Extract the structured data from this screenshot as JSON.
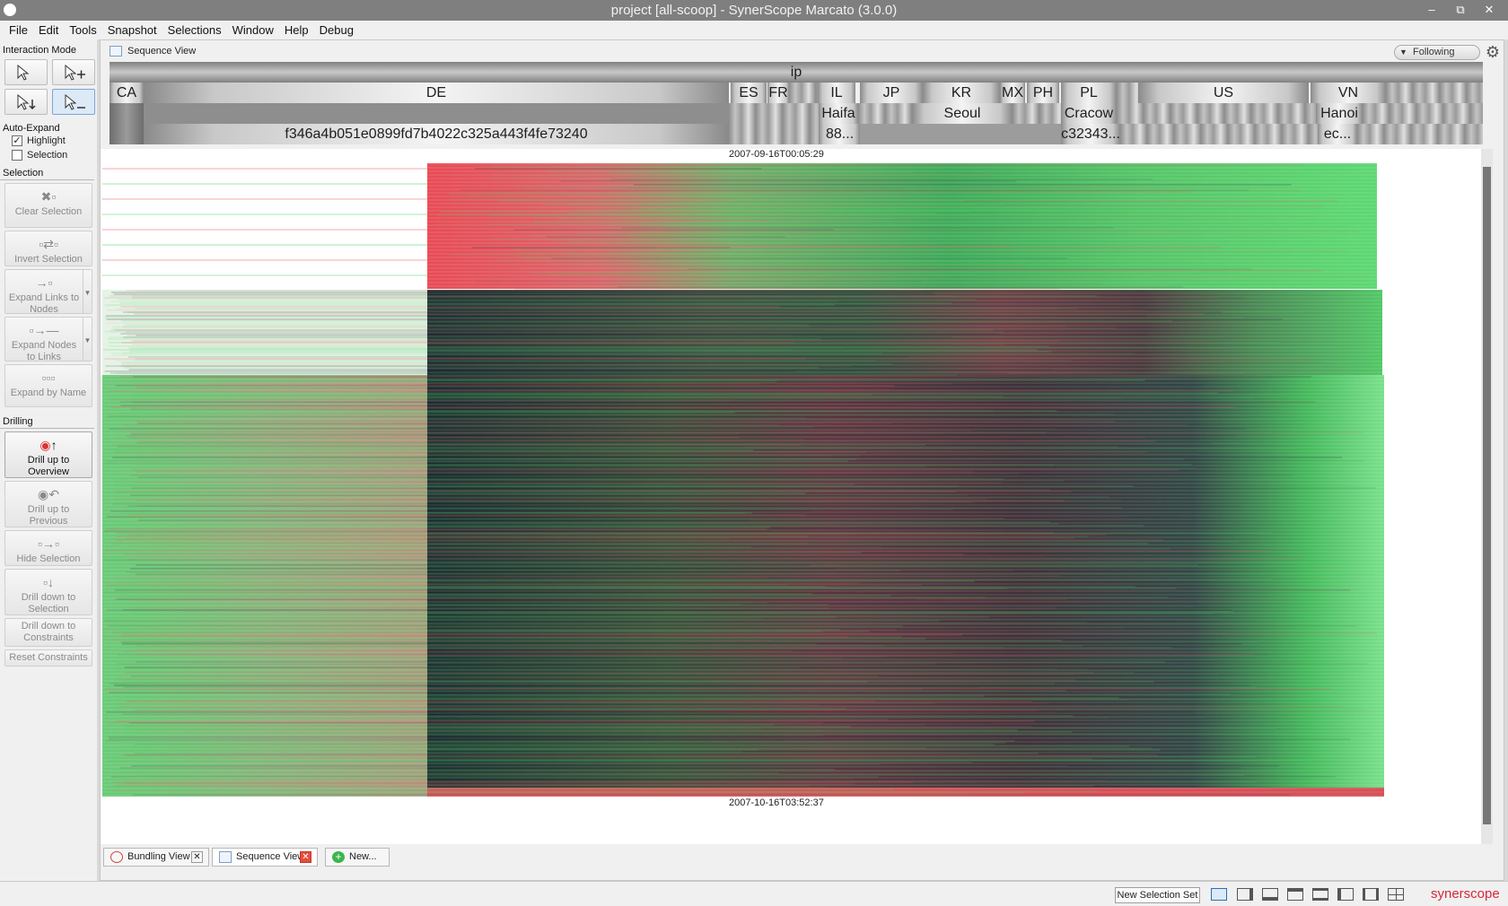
{
  "window": {
    "title": "project [all-scoop] - SynerScope Marcato (3.0.0)"
  },
  "menu": [
    "File",
    "Edit",
    "Tools",
    "Snapshot",
    "Selections",
    "Window",
    "Help",
    "Debug"
  ],
  "left_panel": {
    "interaction_mode_title": "Interaction Mode",
    "auto_expand_title": "Auto-Expand",
    "highlight_label": "Highlight",
    "highlight_checked": true,
    "selection_label": "Selection",
    "selection_checked": false,
    "selection_title": "Selection",
    "clear_selection": "Clear Selection",
    "invert_selection": "Invert Selection",
    "expand_links": "Expand Links to Nodes",
    "expand_nodes": "Expand Nodes to Links",
    "expand_by_name": "Expand by Name",
    "drilling_title": "Drilling",
    "drill_up_overview": "Drill up to Overview",
    "drill_up_previous": "Drill up to Previous",
    "hide_selection": "Hide Selection",
    "drill_down_selection": "Drill down to Selection",
    "drill_down_constraints": "Drill down to Constraints",
    "reset_constraints": "Reset Constraints"
  },
  "view": {
    "title": "Sequence View",
    "following_label": "Following",
    "hierarchy": {
      "root": "ip",
      "countries": [
        "CA",
        "DE",
        "ES",
        "FR",
        "IL",
        "JP",
        "KR",
        "MX",
        "PH",
        "PL",
        "US",
        "VN"
      ],
      "cities": [
        "Haifa",
        "Seoul",
        "Cracow",
        "Hanoi"
      ],
      "hosts": [
        "f346a4b051e0899fd7b4022c325a443f4fe73240",
        "88...",
        "c32343...",
        "ec..."
      ]
    },
    "time_start": "2007-09-16T00:05:29",
    "time_end": "2007-10-16T03:52:37"
  },
  "bottom_tabs": [
    "Bundling View",
    "Sequence View",
    "New..."
  ],
  "status_bar": {
    "new_selection_set": "New Selection Set",
    "brand": "synerscope"
  },
  "colors": {
    "link_green": "#3fd45a",
    "link_red": "#e8545a",
    "link_dark": "#1f2d33",
    "accent": "#2c6fb8"
  }
}
